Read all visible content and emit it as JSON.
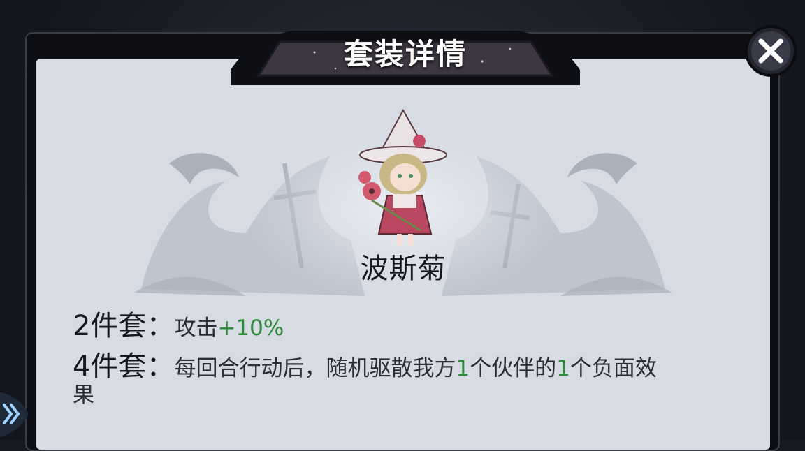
{
  "title": "套装详情",
  "close_icon": "close-x-icon",
  "set": {
    "name": "波斯菊",
    "bonuses": [
      {
        "label": "2件套：",
        "segments": [
          {
            "text": "攻击",
            "green": false
          },
          {
            "text": "+10%",
            "green": true
          }
        ]
      },
      {
        "label": "4件套：",
        "segments": [
          {
            "text": "每回合行动后，随机驱散我方",
            "green": false
          },
          {
            "text": "1",
            "green": true
          },
          {
            "text": "个伙伴的",
            "green": false
          },
          {
            "text": "1",
            "green": true
          },
          {
            "text": "个负面效",
            "green": false
          }
        ],
        "continuation": "果"
      }
    ]
  },
  "colors": {
    "panel": "#d7dbe3",
    "frame": "#0e0f14",
    "highlight_green": "#2f8a3a",
    "title_text": "#ffffff"
  },
  "edge_icon": "double-chevron-right-icon"
}
